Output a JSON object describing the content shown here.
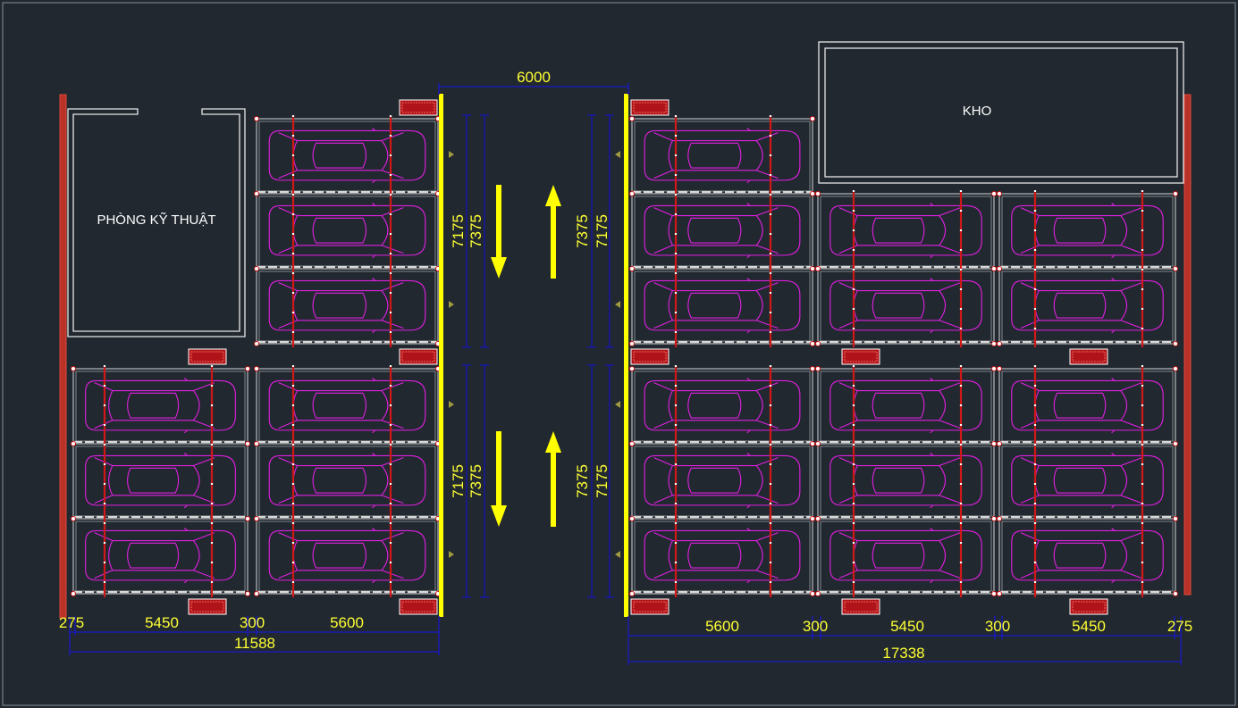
{
  "rooms": {
    "technical_room": "PHÒNG KỸ THUẬT",
    "storage": "KHO"
  },
  "dimensions": {
    "aisle_width": "6000",
    "left_upper_outer": "7175",
    "left_upper_inner": "7375",
    "left_lower_outer": "7175",
    "left_lower_inner": "7375",
    "right_upper_inner": "7375",
    "right_upper_outer": "7175",
    "right_lower_inner": "7375",
    "right_lower_outer": "7175",
    "left_bottom": [
      "275",
      "5450",
      "300",
      "5600"
    ],
    "left_total": "11588",
    "right_bottom": [
      "5600",
      "300",
      "5450",
      "300",
      "5450",
      "275"
    ],
    "right_total": "17338"
  },
  "colors": {
    "background": "#212830",
    "car": "#e020e0",
    "frame": "#d8d8d8",
    "column": "#d01818",
    "dimension": "#1414b4",
    "text": "#ffff33",
    "rail": "#ffff00",
    "wall": "#c0392b"
  },
  "icons": {
    "direction_arrow": "arrow-icon",
    "vehicle": "car-icon",
    "control_panel": "control-panel-icon"
  }
}
